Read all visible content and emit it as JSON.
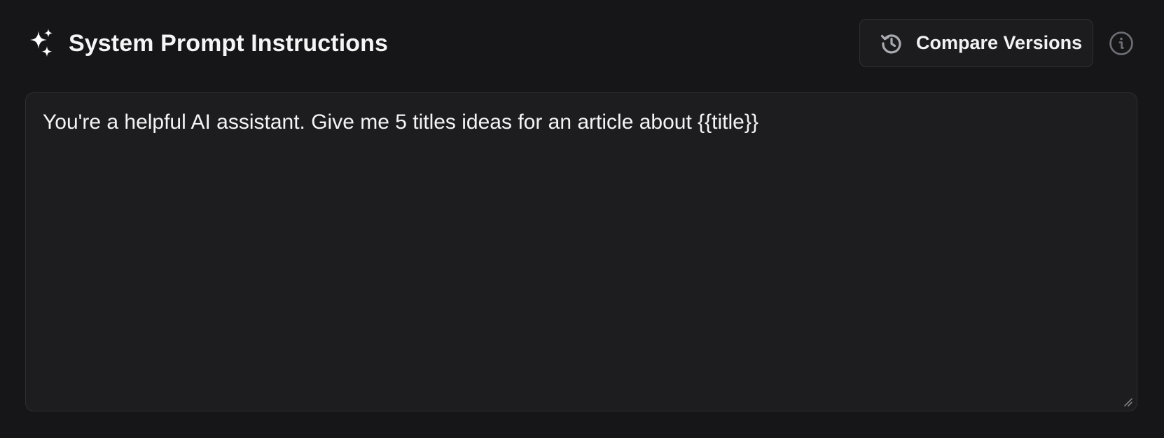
{
  "header": {
    "title": "System Prompt Instructions",
    "title_icon": "sparkle-icon",
    "compare_button": {
      "label": "Compare Versions",
      "icon": "history-icon"
    },
    "info_icon": "info-icon"
  },
  "editor": {
    "value": "You're a helpful AI assistant. Give me 5 titles ideas for an article about {{title}}"
  },
  "colors": {
    "background": "#161618",
    "panel": "#1d1d1f",
    "border": "#2d2e32",
    "text": "#f4f4f5",
    "muted_icon": "#8a8b90"
  }
}
